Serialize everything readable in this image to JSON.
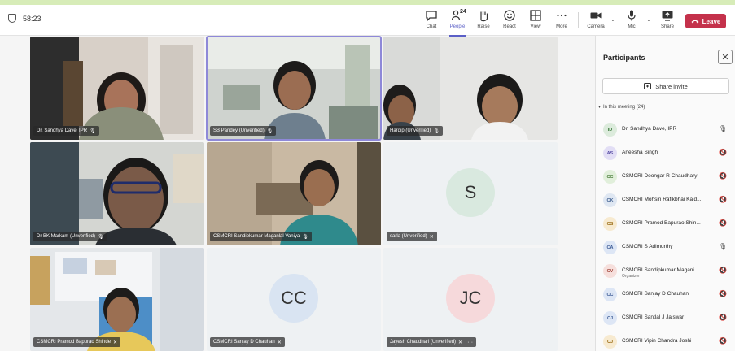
{
  "meeting": {
    "timer": "58:23"
  },
  "toolbar": {
    "chat": "Chat",
    "people": "People",
    "people_count": "24",
    "raise": "Raise",
    "react": "React",
    "view": "View",
    "more": "More",
    "camera": "Camera",
    "mic": "Mic",
    "share": "Share",
    "leave": "Leave"
  },
  "tiles": [
    {
      "name": "Dr. Sandhya Dave, IPR",
      "type": "video",
      "icon": "sandhya"
    },
    {
      "name": "SB Pandey (Unverified)",
      "type": "video",
      "icon": "pandey"
    },
    {
      "name": "Hardip (Unverified)",
      "type": "video",
      "icon": "hardip"
    },
    {
      "name": "Dr BK Markam (Unverified)",
      "type": "video",
      "icon": "markam"
    },
    {
      "name": "CSMCRI Sandipkumar Maganlal Vaniya",
      "type": "video",
      "icon": "vaniya"
    },
    {
      "name": "sarla (Unverified)",
      "type": "avatar",
      "initials": "S",
      "color": "#d9e9df"
    },
    {
      "name": "CSMCRI Pramod Bapurao Shinde",
      "type": "video",
      "icon": "shinde"
    },
    {
      "name": "CSMCRI Sanjay D Chauhan",
      "type": "avatar",
      "initials": "CC",
      "color": "#d9e4f2"
    },
    {
      "name": "Jayesh Chaudhari (Unverified)",
      "type": "avatar",
      "initials": "JC",
      "color": "#f6d9db"
    }
  ],
  "panel": {
    "title": "Participants",
    "share_invite": "Share invite",
    "in_meeting": "In this meeting (24)",
    "participants": [
      {
        "initials": "ID",
        "name": "Dr. Sandhya Dave, IPR",
        "role": "",
        "color": "#dcebdc",
        "text_color": "#3c7a3c",
        "muted": false
      },
      {
        "initials": "AS",
        "name": "Aneesha Singh",
        "role": "",
        "color": "#e2def5",
        "text_color": "#5a4fa6",
        "muted": true
      },
      {
        "initials": "CC",
        "name": "CSMCRI Doongar R Chaudhary",
        "role": "",
        "color": "#e1efdb",
        "text_color": "#4a7d3a",
        "muted": true
      },
      {
        "initials": "CK",
        "name": "CSMCRI Mohsin Rafikbhai Kald...",
        "role": "",
        "color": "#dfe7f2",
        "text_color": "#3f5f8f",
        "muted": true
      },
      {
        "initials": "CS",
        "name": "CSMCRI Pramod Bapurao Shin...",
        "role": "",
        "color": "#f7ead0",
        "text_color": "#9a6b12",
        "muted": true
      },
      {
        "initials": "CA",
        "name": "CSMCRI S Adimurthy",
        "role": "",
        "color": "#dde6f5",
        "text_color": "#3d5c96",
        "muted": false
      },
      {
        "initials": "CV",
        "name": "CSMCRI Sandipkumar Magani...",
        "role": "Organizer",
        "color": "#f6dfdc",
        "text_color": "#a2453a",
        "muted": true
      },
      {
        "initials": "CC",
        "name": "CSMCRI Sanjay D Chauhan",
        "role": "",
        "color": "#dde6f5",
        "text_color": "#3d5c96",
        "muted": true
      },
      {
        "initials": "CJ",
        "name": "CSMCRI Santlal J Jaiswar",
        "role": "",
        "color": "#dde6f5",
        "text_color": "#3d5c96",
        "muted": true
      },
      {
        "initials": "CJ",
        "name": "CSMCRI Vipin Chandra Joshi",
        "role": "",
        "color": "#f7ead0",
        "text_color": "#9a6b12",
        "muted": true
      }
    ]
  }
}
